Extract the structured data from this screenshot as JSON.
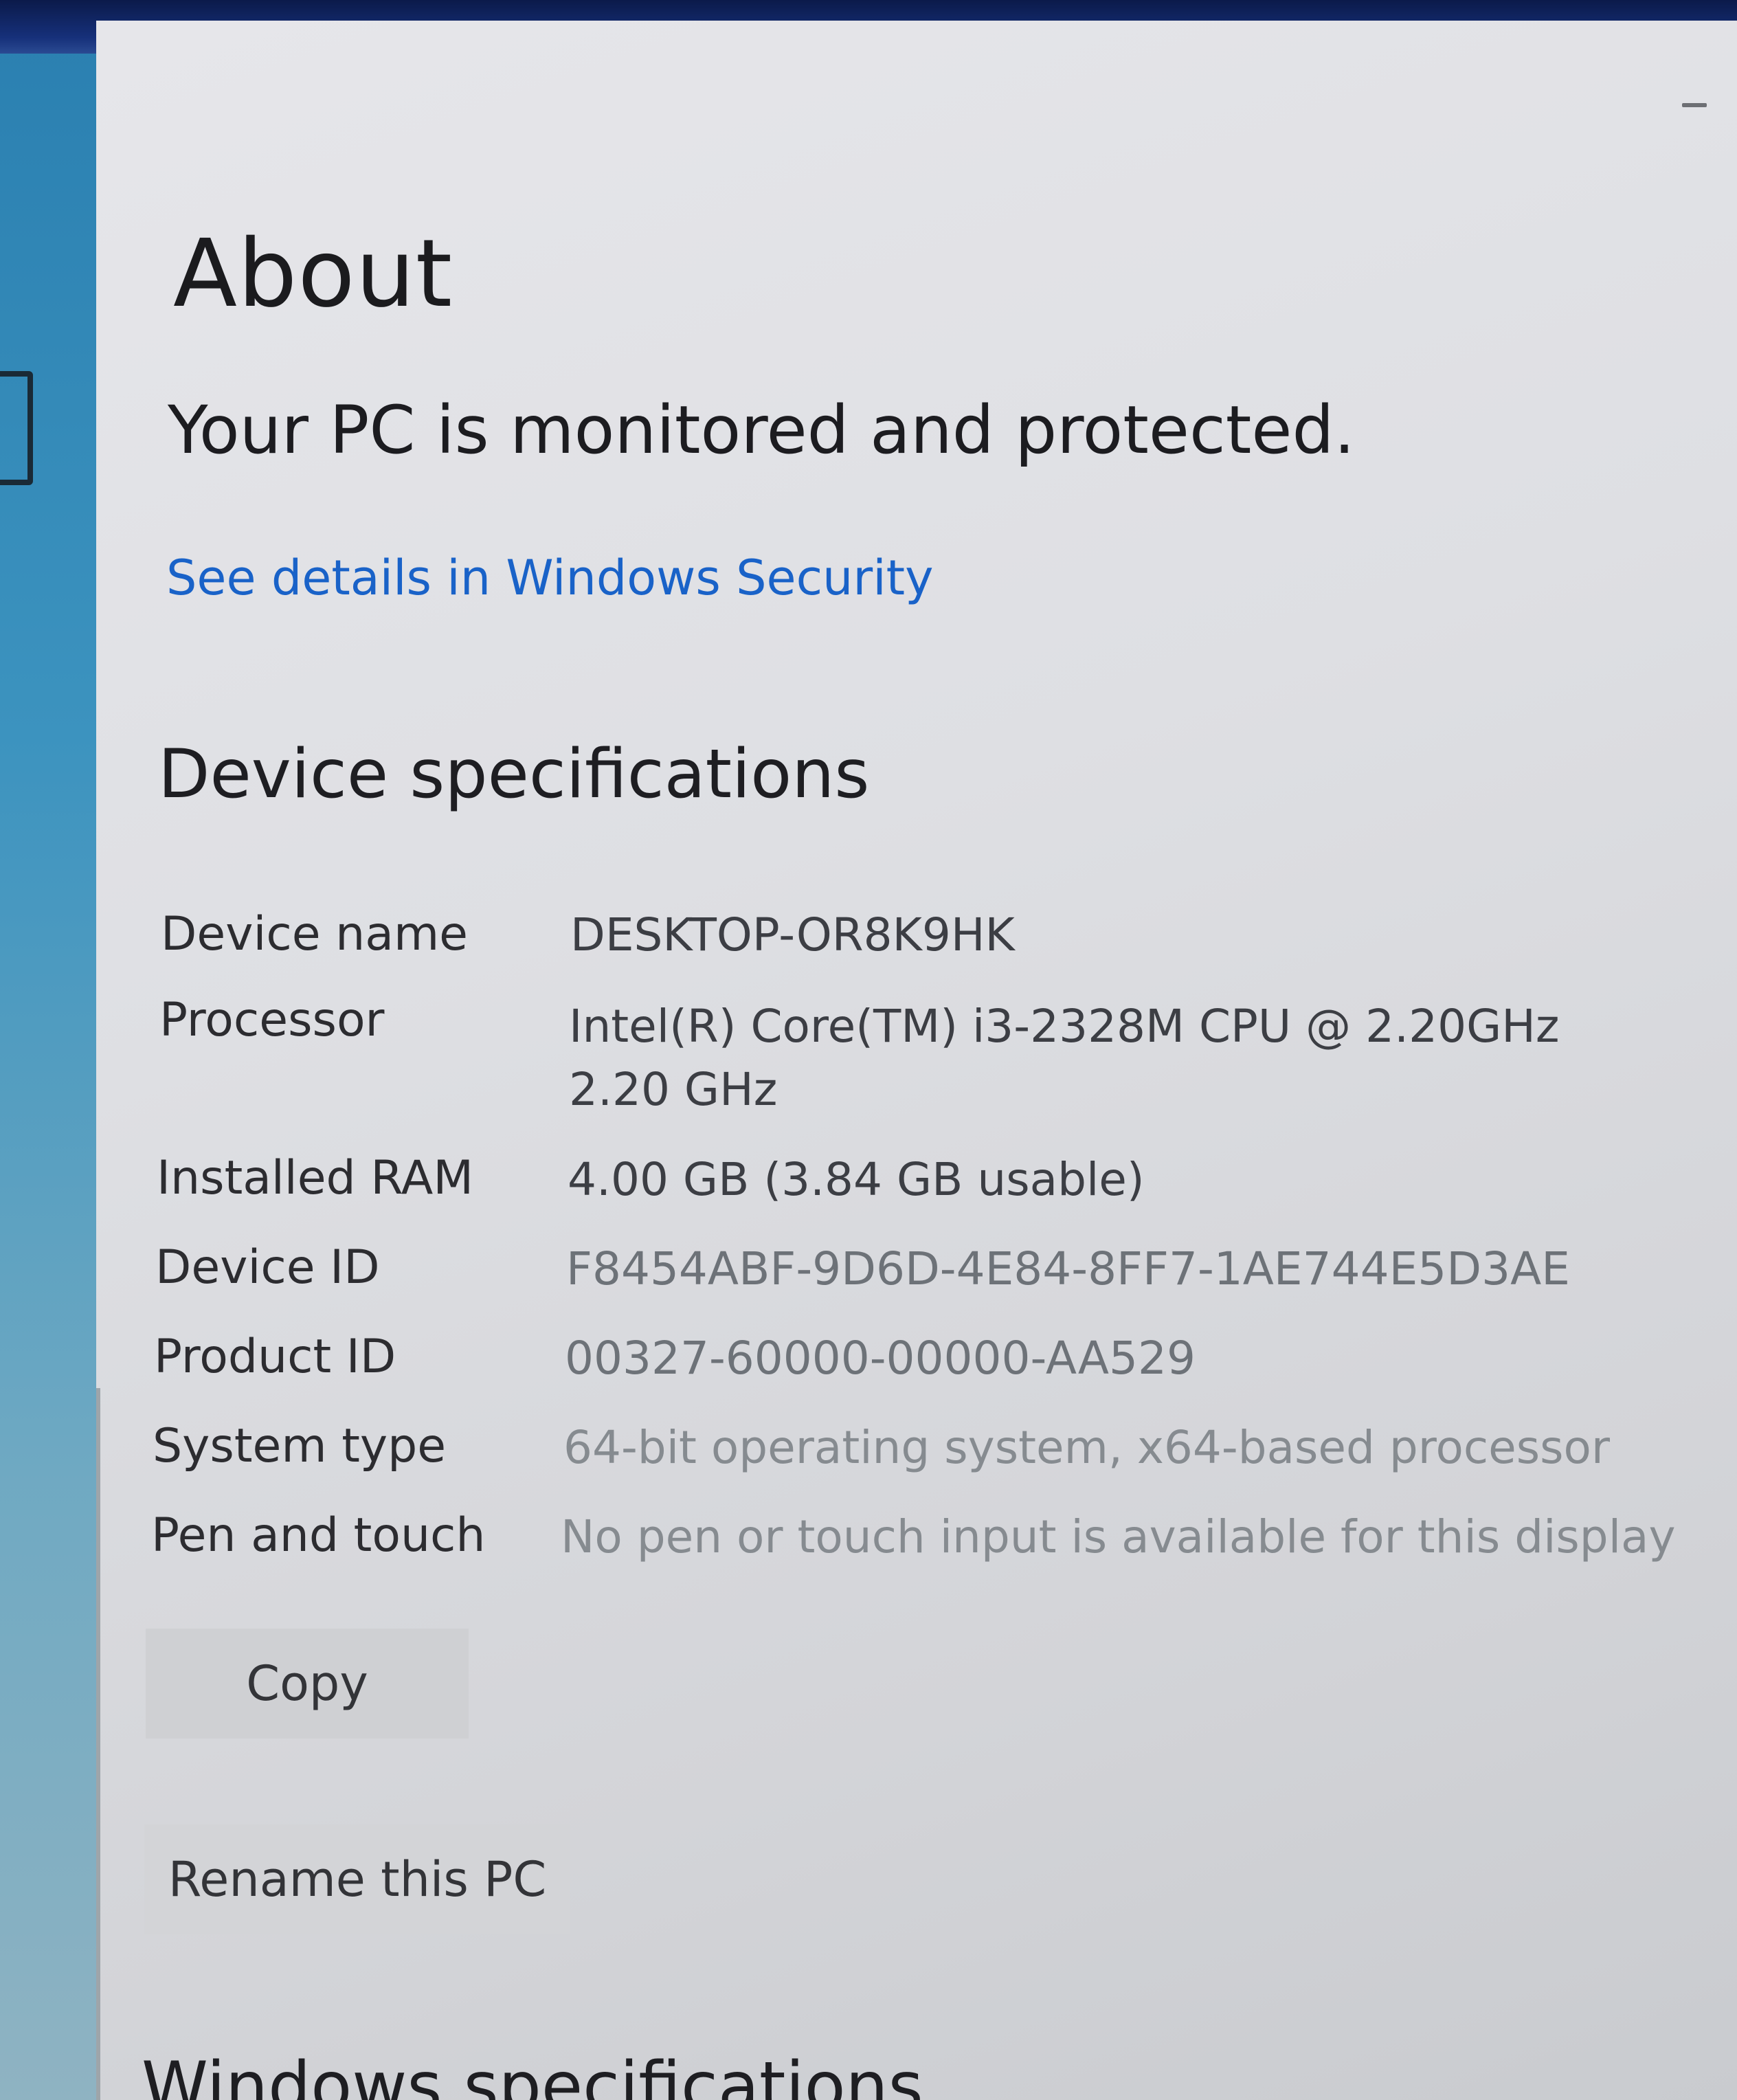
{
  "page": {
    "title": "About"
  },
  "security": {
    "status": "Your PC is monitored and protected.",
    "link": "See details in Windows Security"
  },
  "device_specs": {
    "heading": "Device specifications",
    "rows": [
      {
        "label": "Device name",
        "value": "DESKTOP-OR8K9HK"
      },
      {
        "label": "Processor",
        "value": "Intel(R) Core(TM) i3-2328M CPU @ 2.20GHz   2.20 GHz"
      },
      {
        "label": "Installed RAM",
        "value": "4.00 GB (3.84 GB usable)"
      },
      {
        "label": "Device ID",
        "value": "F8454ABF-9D6D-4E84-8FF7-1AE744E5D3AE"
      },
      {
        "label": "Product ID",
        "value": "00327-60000-00000-AA529"
      },
      {
        "label": "System type",
        "value": "64-bit operating system, x64-based processor"
      },
      {
        "label": "Pen and touch",
        "value": "No pen or touch input is available for this display"
      }
    ],
    "copy_label": "Copy",
    "rename_label": "Rename this PC"
  },
  "windows_specs": {
    "heading": "Windows specifications"
  },
  "colors": {
    "link": "#1962c8",
    "title_bar": "#0b1a4a",
    "sidebar": "#2a7fb0"
  },
  "icons": {
    "minimize": "minimize-icon"
  }
}
